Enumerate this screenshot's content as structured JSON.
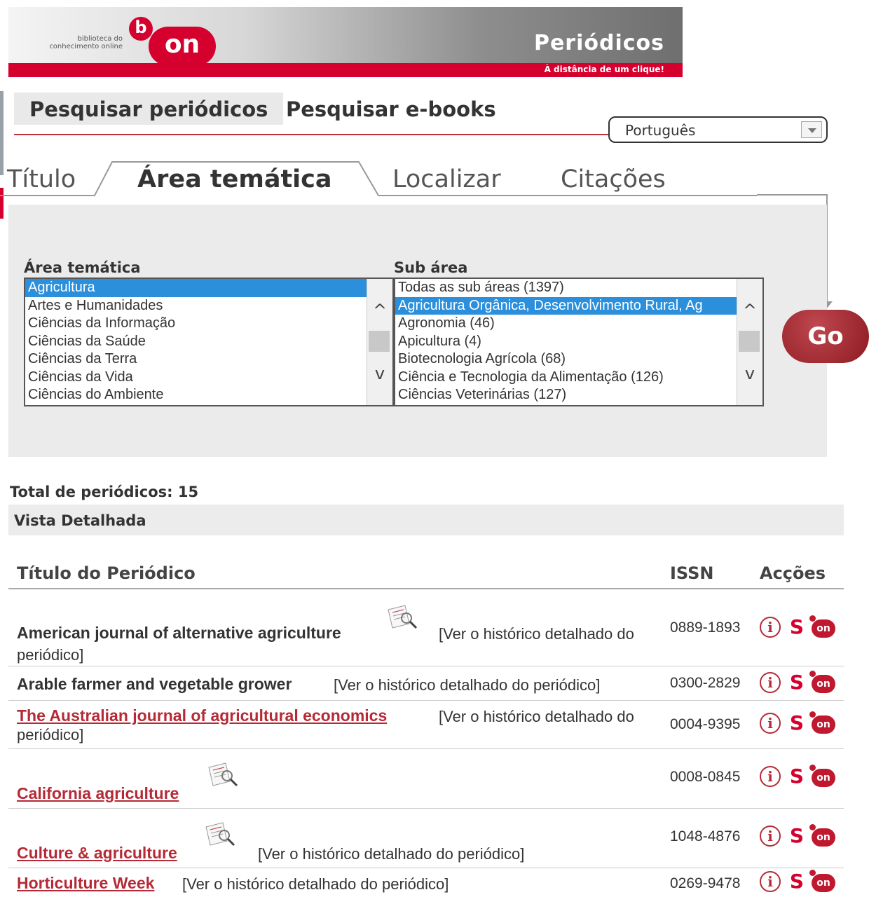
{
  "banner": {
    "logo_text": "biblioteca do conhecimento online",
    "logo_b": "b",
    "logo_on": "on",
    "title": "Periódicos",
    "tagline": "À distância de um clique!"
  },
  "search_tabs": {
    "active": "Pesquisar periódicos",
    "inactive": "Pesquisar e-books"
  },
  "language": {
    "selected": "Português"
  },
  "tabs": {
    "titulo": "Título",
    "area": "Área temática",
    "localizar": "Localizar",
    "citacoes": "Citações"
  },
  "area_list": {
    "label": "Área temática",
    "items": [
      "Agricultura",
      "Artes e Humanidades",
      "Ciências da Informação",
      "Ciências da Saúde",
      "Ciências da Terra",
      "Ciências da Vida",
      "Ciências do Ambiente"
    ],
    "selected_index": 0
  },
  "sub_list": {
    "label": "Sub área",
    "items": [
      "Todas as sub áreas (1397)",
      "Agricultura Orgânica, Desenvolvimento Rural, Ag",
      "Agronomia (46)",
      "Apicultura (4)",
      "Biotecnologia Agrícola (68)",
      "Ciência e Tecnologia da Alimentação (126)",
      "Ciências Veterinárias (127)"
    ],
    "selected_index": 1
  },
  "go_label": "Go",
  "results": {
    "total": "Total de periódicos: 15",
    "view": "Vista Detalhada",
    "headers": {
      "title": "Título do Periódico",
      "issn": "ISSN",
      "acoes": "Acções"
    },
    "hist_full": "[Ver o histórico detalhado do periódico]",
    "hist_part": "[Ver o histórico detalhado do",
    "hist_cont": "periódico]",
    "rows": [
      {
        "title": "American journal of alternative agriculture",
        "issn": "0889-1893"
      },
      {
        "title": "Arable farmer and vegetable grower",
        "issn": "0300-2829"
      },
      {
        "title": "The Australian journal of agricultural economics",
        "issn": "0004-9395"
      },
      {
        "title": "California agriculture",
        "issn": "0008-0845"
      },
      {
        "title": "Culture & agriculture",
        "issn": "1048-4876"
      },
      {
        "title": "Horticulture Week",
        "issn": "0269-9478"
      }
    ]
  },
  "action_labels": {
    "info": "i",
    "s": "S",
    "on": "on"
  },
  "colors": {
    "brand_red": "#d5002e",
    "link_red": "#b52a36",
    "select_blue": "#2b8fdc",
    "panel_gray": "#ebebeb"
  }
}
